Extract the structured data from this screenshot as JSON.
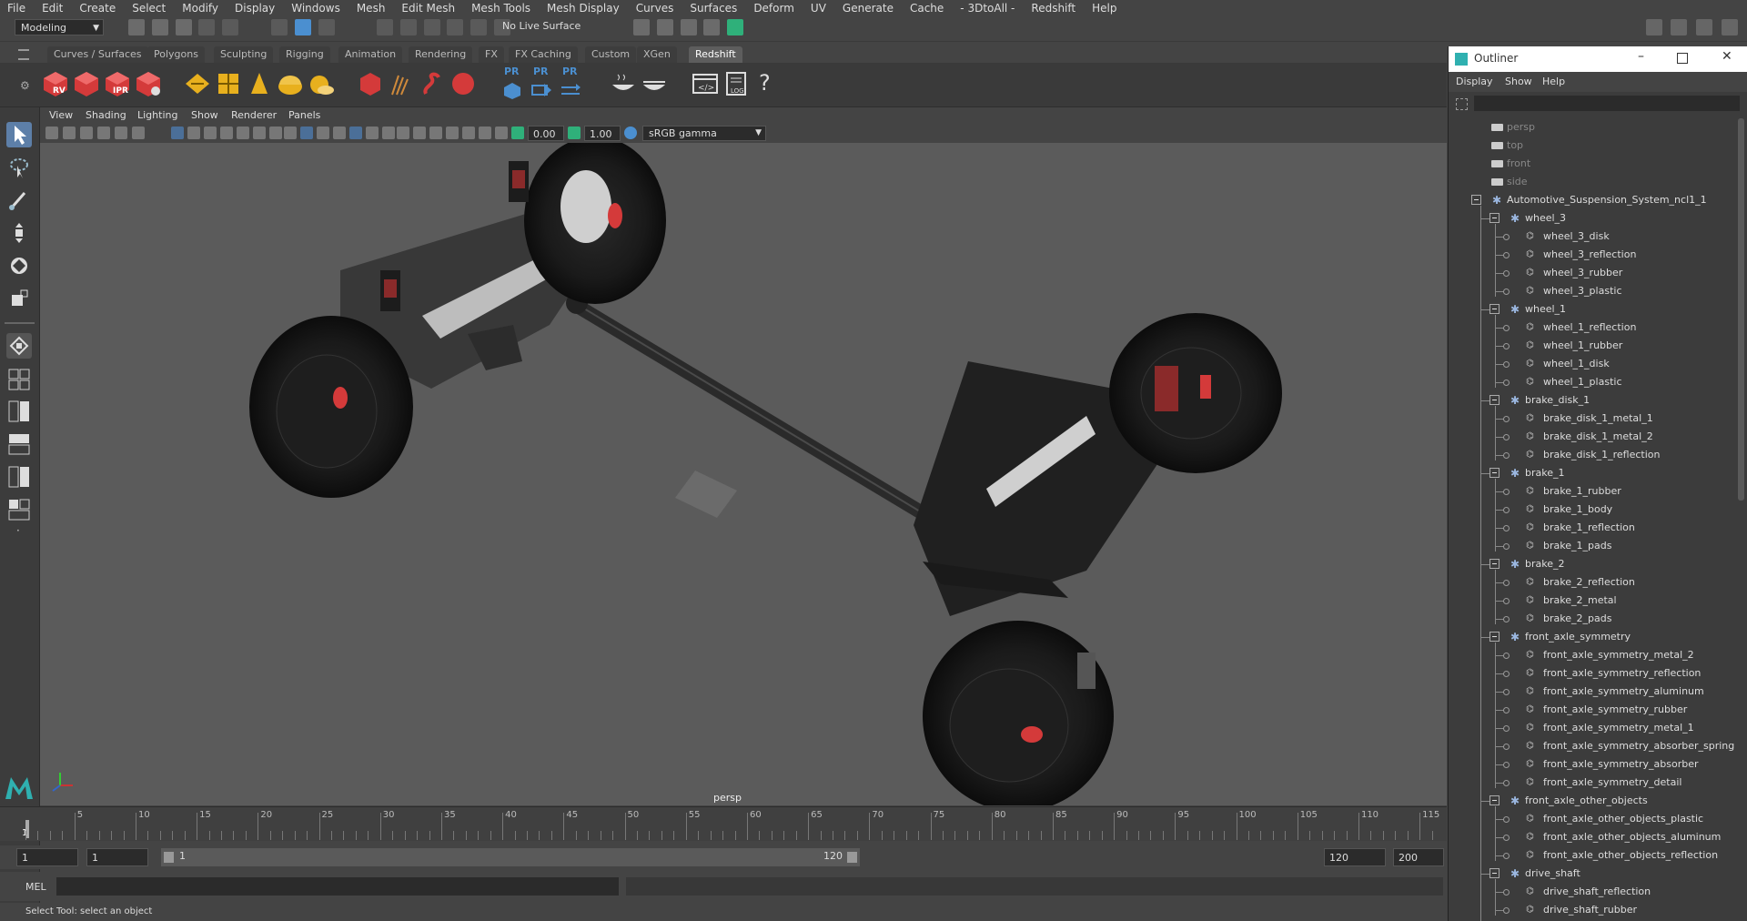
{
  "menubar": [
    "File",
    "Edit",
    "Create",
    "Select",
    "Modify",
    "Display",
    "Windows",
    "Mesh",
    "Edit Mesh",
    "Mesh Tools",
    "Mesh Display",
    "Curves",
    "Surfaces",
    "Deform",
    "UV",
    "Generate",
    "Cache",
    "- 3DtoAll -",
    "Redshift",
    "Help"
  ],
  "status": {
    "mode": "Modeling",
    "live_surface": "No Live Surface"
  },
  "shelf_tabs": [
    "Curves / Surfaces",
    "Polygons",
    "Sculpting",
    "Rigging",
    "Animation",
    "Rendering",
    "FX",
    "FX Caching",
    "Custom",
    "XGen",
    "Redshift"
  ],
  "shelf_active": "Redshift",
  "shelf_labels": {
    "rv": "RV",
    "ipr": "IPR",
    "pr1": "PR",
    "pr2": "PR",
    "pr3": "PR",
    "log": "LOG",
    "help": "?"
  },
  "panel_menu": [
    "View",
    "Shading",
    "Lighting",
    "Show",
    "Renderer",
    "Panels"
  ],
  "viewport_toolbar": {
    "exposure": "0.00",
    "gamma": "1.00",
    "color_space": "sRGB gamma"
  },
  "viewport_label": "persp",
  "timeline": {
    "ticks": [
      "5",
      "10",
      "15",
      "20",
      "25",
      "30",
      "35",
      "40",
      "45",
      "50",
      "55",
      "60",
      "65",
      "70",
      "75",
      "80",
      "85",
      "90",
      "95",
      "100",
      "105",
      "110",
      "115"
    ],
    "current": "1"
  },
  "range": {
    "start": "1",
    "anim_start": "1",
    "slider_start": "1",
    "slider_end": "120",
    "end": "120",
    "anim_end": "200"
  },
  "cmdline": {
    "label": "MEL"
  },
  "helpline": "Select Tool: select an object",
  "outliner": {
    "title": "Outliner",
    "menu": [
      "Display",
      "Show",
      "Help"
    ],
    "rows": [
      {
        "label": "persp",
        "kind": "camera",
        "level": 0
      },
      {
        "label": "top",
        "kind": "camera",
        "level": 0
      },
      {
        "label": "front",
        "kind": "camera",
        "level": 0
      },
      {
        "label": "side",
        "kind": "camera",
        "level": 0
      },
      {
        "label": "Automotive_Suspension_System_ncl1_1",
        "kind": "root",
        "level": 0
      },
      {
        "label": "wheel_3",
        "kind": "group",
        "level": 1
      },
      {
        "label": "wheel_3_disk",
        "kind": "mesh",
        "level": 2
      },
      {
        "label": "wheel_3_reflection",
        "kind": "mesh",
        "level": 2
      },
      {
        "label": "wheel_3_rubber",
        "kind": "mesh",
        "level": 2
      },
      {
        "label": "wheel_3_plastic",
        "kind": "mesh",
        "level": 2
      },
      {
        "label": "wheel_1",
        "kind": "group",
        "level": 1
      },
      {
        "label": "wheel_1_reflection",
        "kind": "mesh",
        "level": 2
      },
      {
        "label": "wheel_1_rubber",
        "kind": "mesh",
        "level": 2
      },
      {
        "label": "wheel_1_disk",
        "kind": "mesh",
        "level": 2
      },
      {
        "label": "wheel_1_plastic",
        "kind": "mesh",
        "level": 2
      },
      {
        "label": "brake_disk_1",
        "kind": "group",
        "level": 1
      },
      {
        "label": "brake_disk_1_metal_1",
        "kind": "mesh",
        "level": 2
      },
      {
        "label": "brake_disk_1_metal_2",
        "kind": "mesh",
        "level": 2
      },
      {
        "label": "brake_disk_1_reflection",
        "kind": "mesh",
        "level": 2
      },
      {
        "label": "brake_1",
        "kind": "group",
        "level": 1
      },
      {
        "label": "brake_1_rubber",
        "kind": "mesh",
        "level": 2
      },
      {
        "label": "brake_1_body",
        "kind": "mesh",
        "level": 2
      },
      {
        "label": "brake_1_reflection",
        "kind": "mesh",
        "level": 2
      },
      {
        "label": "brake_1_pads",
        "kind": "mesh",
        "level": 2
      },
      {
        "label": "brake_2",
        "kind": "group",
        "level": 1
      },
      {
        "label": "brake_2_reflection",
        "kind": "mesh",
        "level": 2
      },
      {
        "label": "brake_2_metal",
        "kind": "mesh",
        "level": 2
      },
      {
        "label": "brake_2_pads",
        "kind": "mesh",
        "level": 2
      },
      {
        "label": "front_axle_symmetry",
        "kind": "group",
        "level": 1
      },
      {
        "label": "front_axle_symmetry_metal_2",
        "kind": "mesh",
        "level": 2
      },
      {
        "label": "front_axle_symmetry_reflection",
        "kind": "mesh",
        "level": 2
      },
      {
        "label": "front_axle_symmetry_aluminum",
        "kind": "mesh",
        "level": 2
      },
      {
        "label": "front_axle_symmetry_rubber",
        "kind": "mesh",
        "level": 2
      },
      {
        "label": "front_axle_symmetry_metal_1",
        "kind": "mesh",
        "level": 2
      },
      {
        "label": "front_axle_symmetry_absorber_spring",
        "kind": "mesh",
        "level": 2
      },
      {
        "label": "front_axle_symmetry_absorber",
        "kind": "mesh",
        "level": 2
      },
      {
        "label": "front_axle_symmetry_detail",
        "kind": "mesh",
        "level": 2
      },
      {
        "label": "front_axle_other_objects",
        "kind": "group",
        "level": 1
      },
      {
        "label": "front_axle_other_objects_plastic",
        "kind": "mesh",
        "level": 2
      },
      {
        "label": "front_axle_other_objects_aluminum",
        "kind": "mesh",
        "level": 2
      },
      {
        "label": "front_axle_other_objects_reflection",
        "kind": "mesh",
        "level": 2
      },
      {
        "label": "drive_shaft",
        "kind": "group",
        "level": 1
      },
      {
        "label": "drive_shaft_reflection",
        "kind": "mesh",
        "level": 2
      },
      {
        "label": "drive_shaft_rubber",
        "kind": "mesh",
        "level": 2
      }
    ]
  },
  "colors": {
    "redshift_red": "#d43a3a",
    "shelf_yellow": "#e8b01e",
    "accent_blue": "#4b8fd0",
    "selection_green": "#2fb07a"
  }
}
